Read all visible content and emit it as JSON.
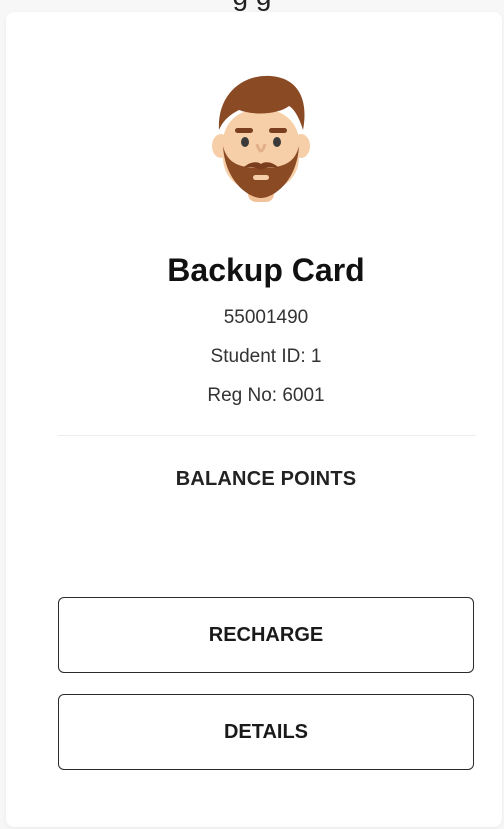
{
  "header": {
    "cut_off_text": "g                                  g"
  },
  "profile": {
    "avatar_icon": "bearded-man-avatar-icon",
    "name": "Backup Card",
    "card_number": "55001490",
    "student_id": "Student ID: 1",
    "reg_no": "Reg No: 6001"
  },
  "balance": {
    "label": "BALANCE POINTS"
  },
  "actions": {
    "recharge_label": "RECHARGE",
    "details_label": "DETAILS"
  },
  "colors": {
    "hair_beard": "#8a4a24",
    "skin": "#f6cfa8",
    "border": "#2a2a2a"
  }
}
